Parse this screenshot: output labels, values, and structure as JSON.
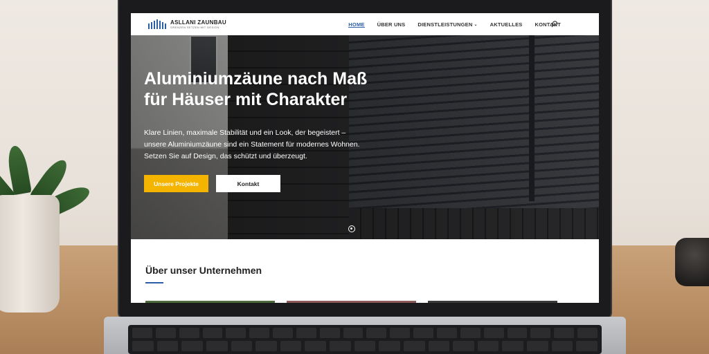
{
  "site": {
    "logo_name": "ASLLANI ZAUNBAU",
    "logo_tagline": "GRENZEN SETZEN MIT DESIGN"
  },
  "nav": {
    "items": [
      {
        "label": "HOME"
      },
      {
        "label": "ÜBER UNS"
      },
      {
        "label": "DIENSTLEISTUNGEN"
      },
      {
        "label": "AKTUELLES"
      },
      {
        "label": "KONTAKT"
      }
    ],
    "active_index": 0,
    "dropdown_chevron": "⌄",
    "search_icon": "search-icon"
  },
  "hero": {
    "title_line1": "Aluminiumzäune nach Maß",
    "title_line2": "für Häuser mit Charakter",
    "text_line1": "Klare Linien, maximale Stabilität und ein Look, der begeistert –",
    "text_line2": "unsere Aluminiumzäune sind ein Statement für modernes Wohnen.",
    "text_line3": "Setzen Sie auf Design, das schützt und überzeugt.",
    "primary_button": "Unsere Projekte",
    "secondary_button": "Kontakt",
    "slides_total": 1,
    "slide_active": 1
  },
  "about": {
    "title": "Über unser Unternehmen"
  },
  "colors": {
    "brand_blue": "#2a5fa8",
    "accent_yellow": "#f5b400",
    "text_dark": "#222222"
  }
}
